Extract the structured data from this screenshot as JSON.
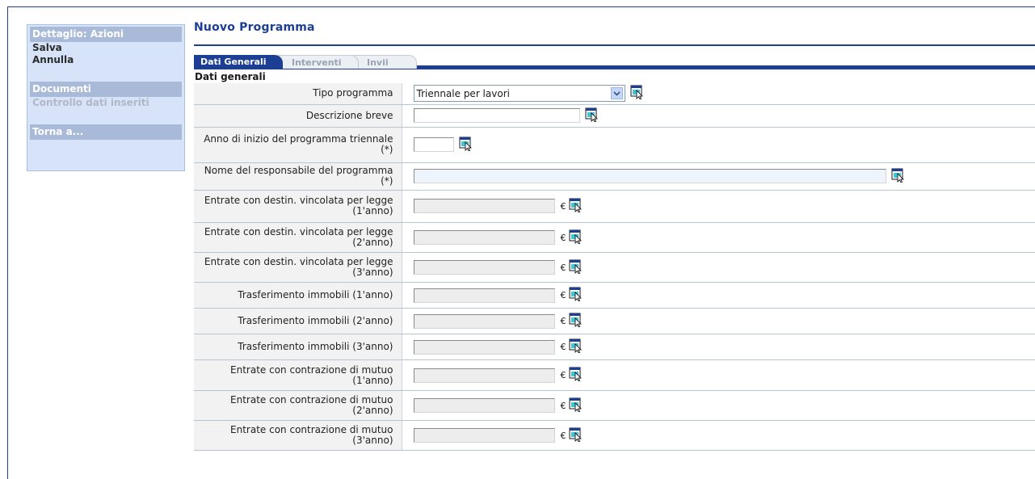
{
  "sidebar": {
    "section_actions": "Dettaglio: Azioni",
    "save": "Salva",
    "cancel": "Annulla",
    "section_documents": "Documenti",
    "check_data": "Controllo dati inseriti",
    "section_back": "Torna a..."
  },
  "page": {
    "title": "Nuovo Programma",
    "section": "Dati generali"
  },
  "tabs": [
    "Dati Generali",
    "Interventi",
    "Invii"
  ],
  "form": {
    "tipo_programma": {
      "label": "Tipo programma",
      "value": "Triennale per lavori"
    },
    "descrizione_breve": {
      "label": "Descrizione breve",
      "value": ""
    },
    "anno_inizio": {
      "label": "Anno di inizio del programma triennale (*)",
      "value": ""
    },
    "nome_responsabile": {
      "label": "Nome del responsabile del programma (*)",
      "value": ""
    },
    "euro_rows": [
      {
        "label": "Entrate con destin. vincolata per legge (1'anno)",
        "value": ""
      },
      {
        "label": "Entrate con destin. vincolata per legge (2'anno)",
        "value": ""
      },
      {
        "label": "Entrate con destin. vincolata per legge (3'anno)",
        "value": ""
      },
      {
        "label": "Trasferimento immobili (1'anno)",
        "value": ""
      },
      {
        "label": "Trasferimento immobili (2'anno)",
        "value": ""
      },
      {
        "label": "Trasferimento immobili (3'anno)",
        "value": ""
      },
      {
        "label": "Entrate con contrazione di mutuo (1'anno)",
        "value": ""
      },
      {
        "label": "Entrate con contrazione di mutuo (2'anno)",
        "value": ""
      },
      {
        "label": "Entrate con contrazione di mutuo (3'anno)",
        "value": ""
      }
    ],
    "currency": "€"
  },
  "colors": {
    "brand": "#1c3f94",
    "sidebar_bg": "#d6e3f8",
    "sidebar_header": "#a9bad9"
  },
  "icons": {
    "help": "help-pointer-icon",
    "dropdown": "chevron-down-icon"
  }
}
